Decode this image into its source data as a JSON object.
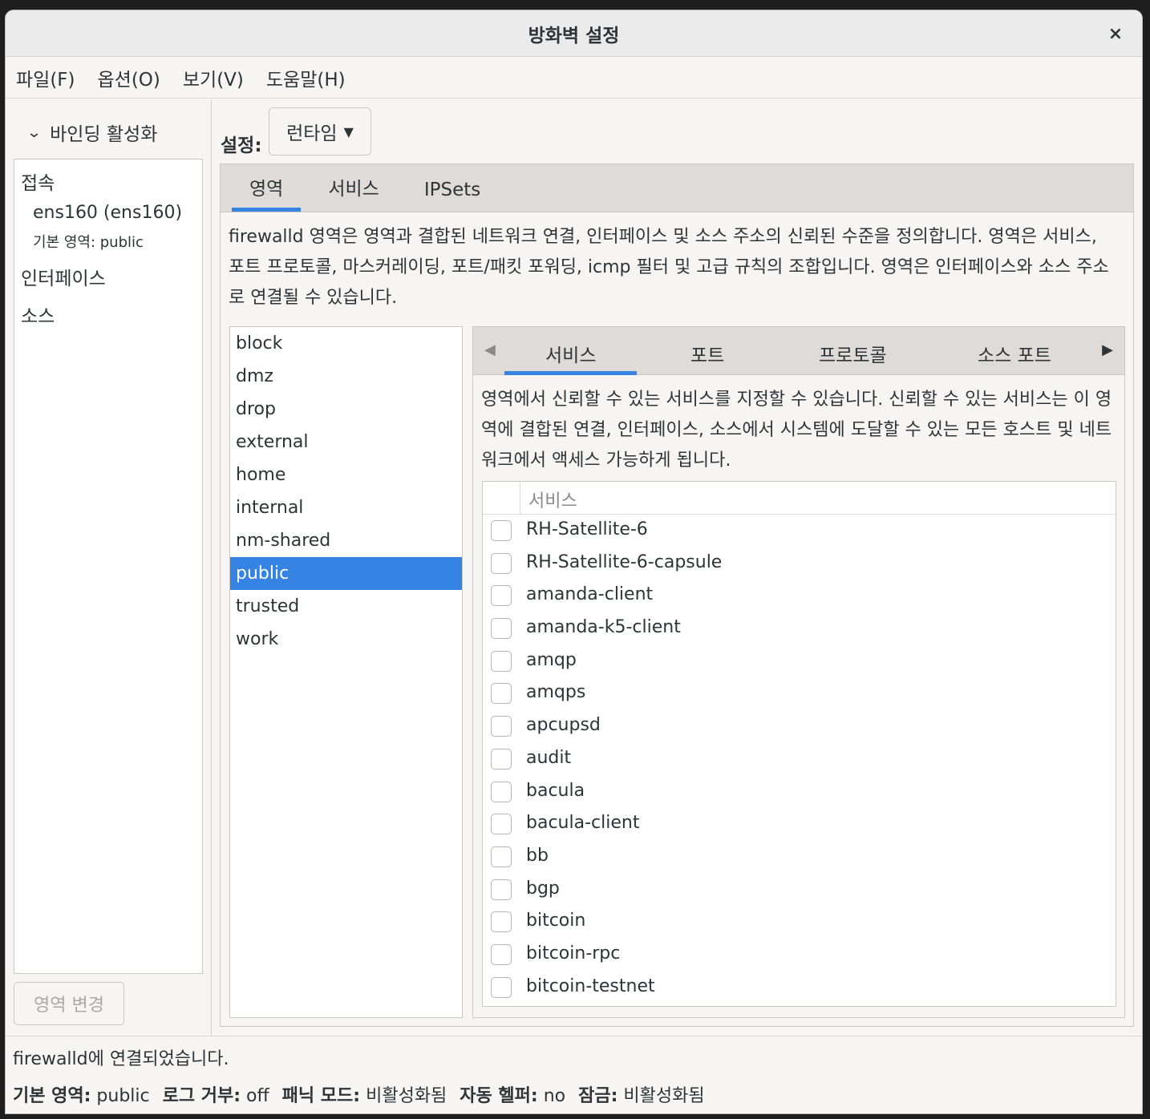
{
  "window": {
    "title": "방화벽 설정",
    "close_glyph": "×"
  },
  "menu": [
    "파일(F)",
    "옵션(O)",
    "보기(V)",
    "도움말(H)"
  ],
  "left": {
    "binding_label": "바인딩 활성화",
    "connections_header": "접속",
    "connection_name": "ens160 (ens160)",
    "connection_zone": "기본 영역: public",
    "interfaces_header": "인터페이스",
    "sources_header": "소스",
    "change_zone_button": "영역 변경"
  },
  "config": {
    "label": "설정:",
    "value": "런타임"
  },
  "main_tabs": [
    "영역",
    "서비스",
    "IPSets"
  ],
  "zone_description": "firewalld 영역은 영역과 결합된 네트워크 연결, 인터페이스 및 소스 주소의 신뢰된 수준을 정의합니다. 영역은 서비스, 포트 프로토콜, 마스커레이딩, 포트/패킷 포워딩, icmp 필터 및 고급 규칙의 조합입니다. 영역은 인터페이스와 소스 주소로 연결될 수 있습니다.",
  "zones": [
    "block",
    "dmz",
    "drop",
    "external",
    "home",
    "internal",
    "nm-shared",
    "public",
    "trusted",
    "work"
  ],
  "selected_zone": "public",
  "sub_tabs": [
    "서비스",
    "포트",
    "프로토콜",
    "소스 포트"
  ],
  "services_description": "영역에서 신뢰할 수 있는 서비스를 지정할 수 있습니다. 신뢰할 수 있는 서비스는 이 영역에 결합된 연결, 인터페이스, 소스에서 시스템에 도달할 수 있는 모든 호스트 및 네트워크에서 액세스 가능하게 됩니다.",
  "services_column": "서비스",
  "services": [
    "RH-Satellite-6",
    "RH-Satellite-6-capsule",
    "amanda-client",
    "amanda-k5-client",
    "amqp",
    "amqps",
    "apcupsd",
    "audit",
    "bacula",
    "bacula-client",
    "bb",
    "bgp",
    "bitcoin",
    "bitcoin-rpc",
    "bitcoin-testnet"
  ],
  "status": {
    "message": "firewalld에 연결되었습니다.",
    "default_zone_label": "기본 영역:",
    "default_zone": "public",
    "log_denied_label": "로그 거부:",
    "log_denied": "off",
    "panic_label": "패닉 모드:",
    "panic": "비활성화됨",
    "helper_label": "자동 헬퍼:",
    "helper": "no",
    "lock_label": "잠금:",
    "lock": "비활성화됨"
  },
  "colors": {
    "accent": "#3584e4"
  }
}
